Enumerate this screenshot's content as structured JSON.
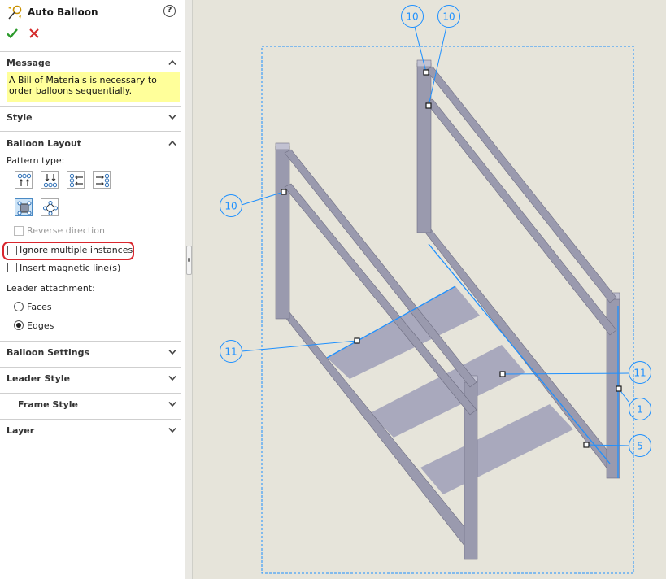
{
  "panel": {
    "title": "Auto Balloon",
    "help": "?",
    "message_header": "Message",
    "message_text": "A Bill of Materials is necessary to order balloons sequentially.",
    "style_header": "Style",
    "layout_header": "Balloon Layout",
    "pattern_type_label": "Pattern type:",
    "reverse_direction": "Reverse direction",
    "ignore_multiple": "Ignore multiple instances",
    "insert_magnetic": "Insert magnetic line(s)",
    "leader_attachment": "Leader attachment:",
    "faces": "Faces",
    "edges": "Edges",
    "balloon_settings": "Balloon Settings",
    "leader_style": "Leader Style",
    "frame_style": "Frame Style",
    "layer": "Layer"
  },
  "viewport": {
    "balloons": [
      {
        "label": "10"
      },
      {
        "label": "10"
      },
      {
        "label": "10"
      },
      {
        "label": "11"
      },
      {
        "label": "11"
      },
      {
        "label": "1"
      },
      {
        "label": "5"
      }
    ]
  },
  "colors": {
    "accent": "#1e90ff",
    "frame": "#9a9aae",
    "step": "#a9a9bd",
    "highlight": "#d9272e",
    "message_bg": "#ffff9a"
  }
}
